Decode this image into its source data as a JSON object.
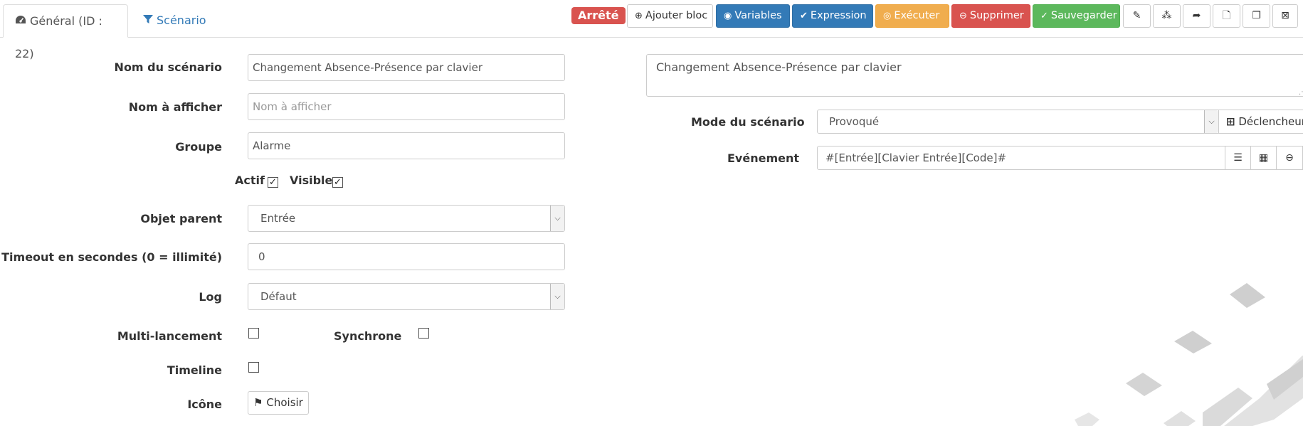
{
  "tabs": {
    "general_label": "Général (ID : 22)",
    "scenario_label": "Scénario"
  },
  "toolbar": {
    "status_badge": "Arrêté",
    "add_block": "Ajouter bloc",
    "variables": "Variables",
    "expression": "Expression",
    "execute": "Exécuter",
    "delete": "Supprimer",
    "save": "Sauvegarder"
  },
  "form": {
    "name_label": "Nom du scénario",
    "name_value": "Changement Absence-Présence par clavier",
    "display_label": "Nom à afficher",
    "display_placeholder": "Nom à afficher",
    "group_label": "Groupe",
    "group_value": "Alarme",
    "active_label": "Actif",
    "visible_label": "Visible",
    "parent_label": "Objet parent",
    "parent_value": "Entrée",
    "timeout_label": "Timeout en secondes (0 = illimité)",
    "timeout_value": "0",
    "log_label": "Log",
    "log_value": "Défaut",
    "multi_label": "Multi-lancement",
    "sync_label": "Synchrone",
    "timeline_label": "Timeline",
    "icon_label": "Icône",
    "choose_button": "Choisir"
  },
  "right": {
    "description": "Changement Absence-Présence par clavier",
    "mode_label": "Mode du scénario",
    "mode_value": "Provoqué",
    "trigger_button": "Déclencheur",
    "event_label": "Evénement",
    "event_value": "#[Entrée][Clavier Entrée][Code]#"
  },
  "colors": {
    "primary": "#337ab7",
    "danger": "#d9534f",
    "warning": "#f0ad4e",
    "success": "#5cb85c"
  },
  "icons": {
    "general_tab": "dashboard-icon",
    "scenario_tab": "filter-icon",
    "add_block": "plus-circle-icon",
    "variables": "eye-icon",
    "expression": "check-icon",
    "execute": "gamepad-icon",
    "delete": "minus-circle-icon",
    "save": "check-circle-icon",
    "choose": "flag-icon"
  }
}
